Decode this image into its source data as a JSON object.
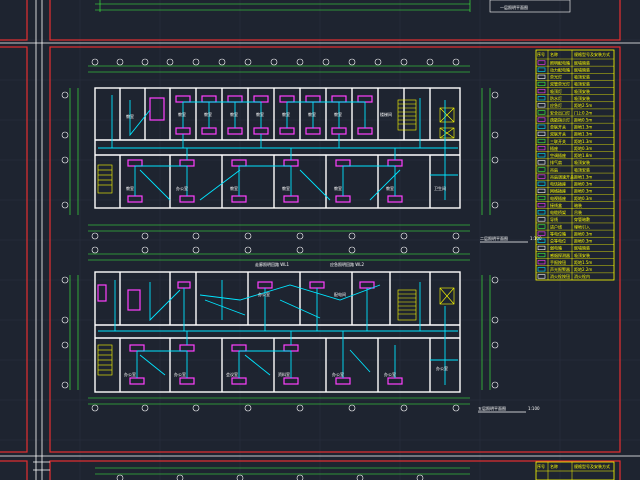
{
  "drawing": {
    "upper_plan_title": "二层照明平面图",
    "upper_plan_scale": "1:100",
    "lower_plan_title": "五层照明平面图",
    "lower_plan_scale": "1:100",
    "lower_plan_note": "走廊照明回路 WL1",
    "lower_plan_note2": "应急照明回路 WL2"
  },
  "upper_rooms": [
    "教室",
    "教室",
    "教室",
    "教室",
    "教室",
    "教室",
    "教室",
    "楼梯间",
    "教室",
    "办公室",
    "教室",
    "教室",
    "教室",
    "教室",
    "教室",
    "卫生间"
  ],
  "lower_rooms": [
    "办公室",
    "办公室",
    "会议室",
    "资料室",
    "办公室",
    "办公室",
    "办公室",
    "配电间",
    "办公室"
  ],
  "legend": {
    "header": [
      "序号",
      "名称",
      "规格型号及安装方式"
    ],
    "rows": [
      [
        "1",
        "照明配电箱",
        "嵌墙暗装"
      ],
      [
        "2",
        "动力配电箱",
        "嵌墙暗装"
      ],
      [
        "3",
        "荧光灯",
        "吸顶安装"
      ],
      [
        "4",
        "双管荧光灯",
        "吸顶安装"
      ],
      [
        "5",
        "吸顶灯",
        "吸顶安装"
      ],
      [
        "6",
        "防水灯",
        "吸顶安装"
      ],
      [
        "7",
        "应急灯",
        "距地2.5m"
      ],
      [
        "8",
        "安全出口灯",
        "门上0.2m"
      ],
      [
        "9",
        "疏散指示灯",
        "距地0.5m"
      ],
      [
        "10",
        "单联开关",
        "距地1.3m"
      ],
      [
        "11",
        "双联开关",
        "距地1.3m"
      ],
      [
        "12",
        "三联开关",
        "距地1.3m"
      ],
      [
        "13",
        "插座",
        "距地0.3m"
      ],
      [
        "14",
        "空调插座",
        "距地1.8m"
      ],
      [
        "15",
        "排气扇",
        "吸顶安装"
      ],
      [
        "16",
        "吊扇",
        "吸顶安装"
      ],
      [
        "17",
        "吊扇调速开关",
        "距地1.3m"
      ],
      [
        "18",
        "电话插座",
        "距地0.3m"
      ],
      [
        "19",
        "网络插座",
        "距地0.3m"
      ],
      [
        "20",
        "电视插座",
        "距地0.3m"
      ],
      [
        "21",
        "接线盒",
        "暗装"
      ],
      [
        "22",
        "电缆桥架",
        "吊装"
      ],
      [
        "23",
        "导线",
        "穿管暗敷"
      ],
      [
        "24",
        "进户线",
        "埋地引入"
      ],
      [
        "25",
        "等电位箱",
        "距地0.3m"
      ],
      [
        "26",
        "总等电位",
        "距地0.3m"
      ],
      [
        "27",
        "弱电箱",
        "嵌墙暗装"
      ],
      [
        "28",
        "感烟探测器",
        "吸顶安装"
      ],
      [
        "29",
        "手报按钮",
        "距地1.5m"
      ],
      [
        "30",
        "声光报警器",
        "距地2.2m"
      ],
      [
        "31",
        "消火栓按钮",
        "消火栓内"
      ]
    ]
  },
  "legend2_header": [
    "序号",
    "名称",
    "规格型号及安装方式"
  ],
  "top_strip_title": "一层照明平面图",
  "colors": {
    "background": "#1e2430",
    "frame": "#e53030",
    "wall": "#ffffff",
    "dim": "#40ff40",
    "circuit": "#00e5ff",
    "fixture": "#ff40ff",
    "legend": "#ffff00"
  }
}
